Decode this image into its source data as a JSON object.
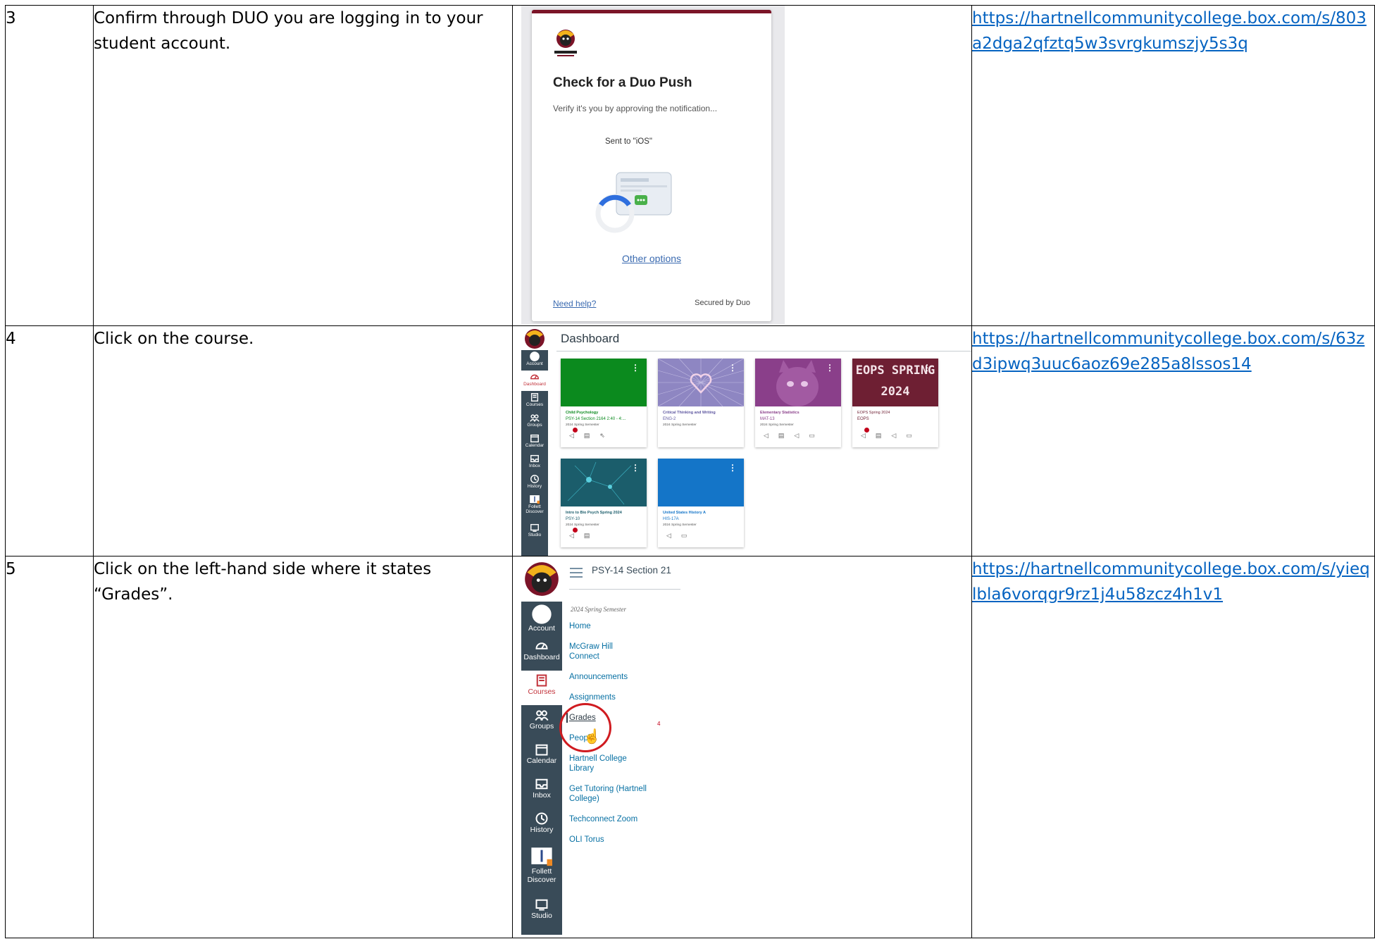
{
  "rows": [
    {
      "step": "3",
      "instruction": "Confirm through DUO you are logging in to your student account.",
      "link": "https://hartnellcommunitycollege.box.com/s/803a2dga2qfztq5w3svrgkumszjy5s3q",
      "screenshot": {
        "logo_text": "HARTNELL COLLEGE",
        "title": "Check for a Duo Push",
        "subtitle": "Verify it's you by approving the notification...",
        "sent_to": "Sent to \"iOS\"",
        "other_options": "Other options",
        "need_help": "Need help?",
        "secured_by": "Secured by Duo",
        "accent_color": "#7b1428"
      }
    },
    {
      "step": "4",
      "instruction": "Click on the course.",
      "link": "https://hartnellcommunitycollege.box.com/s/63zd3ipwq3uuc6aoz69e285a8lssos14",
      "screenshot": {
        "title": "Dashboard",
        "nav": [
          "Account",
          "Dashboard",
          "Courses",
          "Groups",
          "Calendar",
          "Inbox",
          "History",
          "Follett Discover",
          "Studio"
        ],
        "cards": [
          {
            "name": "Child Psychology",
            "code": "PSY-14 Section 2164 2:40 - 4:...",
            "term": "2024 Spring Semester",
            "color": "#0b8a1e"
          },
          {
            "name": "Critical Thinking and Writing",
            "code": "ENG-2",
            "term": "2024 Spring Semester",
            "color": "#8e86c2"
          },
          {
            "name": "Elementary Statistics",
            "code": "MAT-13",
            "term": "2024 Spring Semester",
            "color": "#8a3f8a"
          },
          {
            "name": "EOPS Spring 2024",
            "code": "EOPS",
            "term": "",
            "color": "#6e1f33",
            "hero_text": "EOPS SPRING 2024"
          },
          {
            "name": "Intro to Bio Psych Spring 2024",
            "code": "PSY-10",
            "term": "2024 Spring Semester",
            "color": "#1b5d6b"
          },
          {
            "name": "United States History A",
            "code": "HIS-17A",
            "term": "2024 Spring Semester",
            "color": "#1475c8"
          }
        ]
      }
    },
    {
      "step": "5",
      "instruction": "Click on the left-hand side where it states “Grades”.",
      "link": "https://hartnellcommunitycollege.box.com/s/yieqlbla6vorqgr9rz1j4u58zcz4h1v1",
      "screenshot": {
        "course_title": "PSY-14 Section 21",
        "term": "2024 Spring Semester",
        "nav": [
          "Account",
          "Dashboard",
          "Courses",
          "Groups",
          "Calendar",
          "Inbox",
          "History",
          "Follett Discover",
          "Studio"
        ],
        "menu": [
          "Home",
          "McGraw Hill Connect",
          "Announcements",
          "Assignments",
          "Grades",
          "People",
          "Hartnell College Library",
          "Get Tutoring (Hartnell College)",
          "Techconnect Zoom",
          "OLI Torus"
        ],
        "grades_badge": "4",
        "highlight_color": "#d01b20"
      }
    }
  ]
}
